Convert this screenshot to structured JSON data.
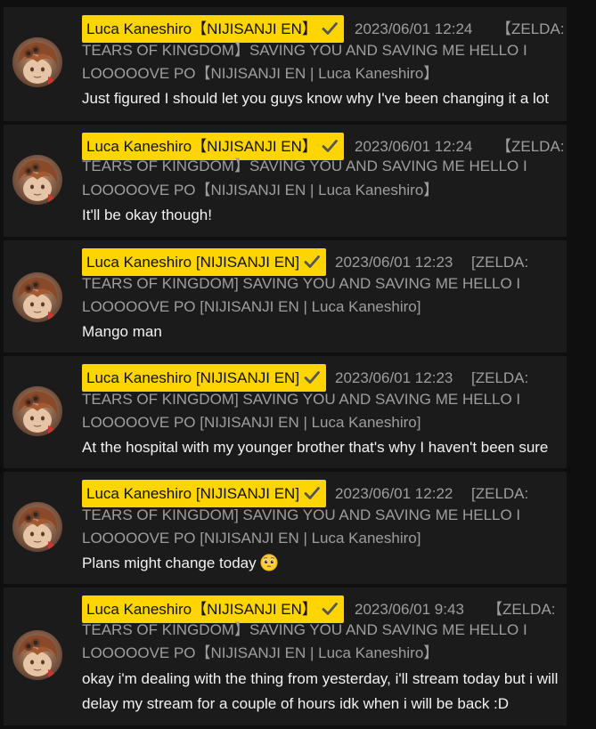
{
  "colors": {
    "page_bg": "#0f0f0f",
    "card_bg": "#1b1b1b",
    "badge_bg": "#ffd500",
    "meta_text": "#9e9e9e",
    "message_text": "#f2f2f2"
  },
  "messages": [
    {
      "author": "Luca Kaneshiro【NIJISANJI EN】",
      "verified_icon": "check-icon",
      "timestamp": "2023/06/01 12:24",
      "title_line1_tail": "【ZELDA:",
      "title_line2": "TEARS OF KINGDOM】SAVING YOU AND SAVING ME HELLO I",
      "title_line3": "LOOOOOVE PO【NIJISANJI EN | Luca Kaneshiro】",
      "text": "Just figured I should let you guys know why I've been changing it a lot"
    },
    {
      "author": "Luca Kaneshiro【NIJISANJI EN】",
      "verified_icon": "check-icon",
      "timestamp": "2023/06/01 12:24",
      "title_line1_tail": "【ZELDA:",
      "title_line2": "TEARS OF KINGDOM】SAVING YOU AND SAVING ME HELLO I",
      "title_line3": "LOOOOOVE PO【NIJISANJI EN | Luca Kaneshiro】",
      "text": "It'll be okay though!"
    },
    {
      "author": "Luca Kaneshiro [NIJISANJI EN]",
      "verified_icon": "check-icon",
      "timestamp": "2023/06/01 12:23",
      "title_line1_tail": "[ZELDA:",
      "title_line2": "TEARS OF KINGDOM] SAVING YOU AND SAVING ME HELLO I",
      "title_line3": "LOOOOOVE PO [NIJISANJI EN | Luca Kaneshiro]",
      "text": "Mango man"
    },
    {
      "author": "Luca Kaneshiro [NIJISANJI EN]",
      "verified_icon": "check-icon",
      "timestamp": "2023/06/01 12:23",
      "title_line1_tail": "[ZELDA:",
      "title_line2": "TEARS OF KINGDOM] SAVING YOU AND SAVING ME HELLO I",
      "title_line3": "LOOOOOVE PO [NIJISANJI EN | Luca Kaneshiro]",
      "text": "At the hospital with my younger brother that's why I haven't been sure"
    },
    {
      "author": "Luca Kaneshiro [NIJISANJI EN]",
      "verified_icon": "check-icon",
      "timestamp": "2023/06/01 12:22",
      "title_line1_tail": "[ZELDA:",
      "title_line2": "TEARS OF KINGDOM] SAVING YOU AND SAVING ME HELLO I",
      "title_line3": "LOOOOOVE PO [NIJISANJI EN | Luca Kaneshiro]",
      "text": "Plans might change today",
      "emoji_icon": "pleading-face-emoji-icon"
    },
    {
      "author": "Luca Kaneshiro【NIJISANJI EN】",
      "verified_icon": "check-icon",
      "timestamp": "2023/06/01 9:43",
      "title_line1_tail": "【ZELDA:",
      "title_line2": "TEARS OF KINGDOM】SAVING YOU AND SAVING ME HELLO I",
      "title_line3": "LOOOOOVE PO【NIJISANJI EN | Luca Kaneshiro】",
      "text": "okay i'm dealing with the thing from yesterday, i'll stream today but i will delay my stream for a couple of hours idk when i will be back :D"
    }
  ]
}
